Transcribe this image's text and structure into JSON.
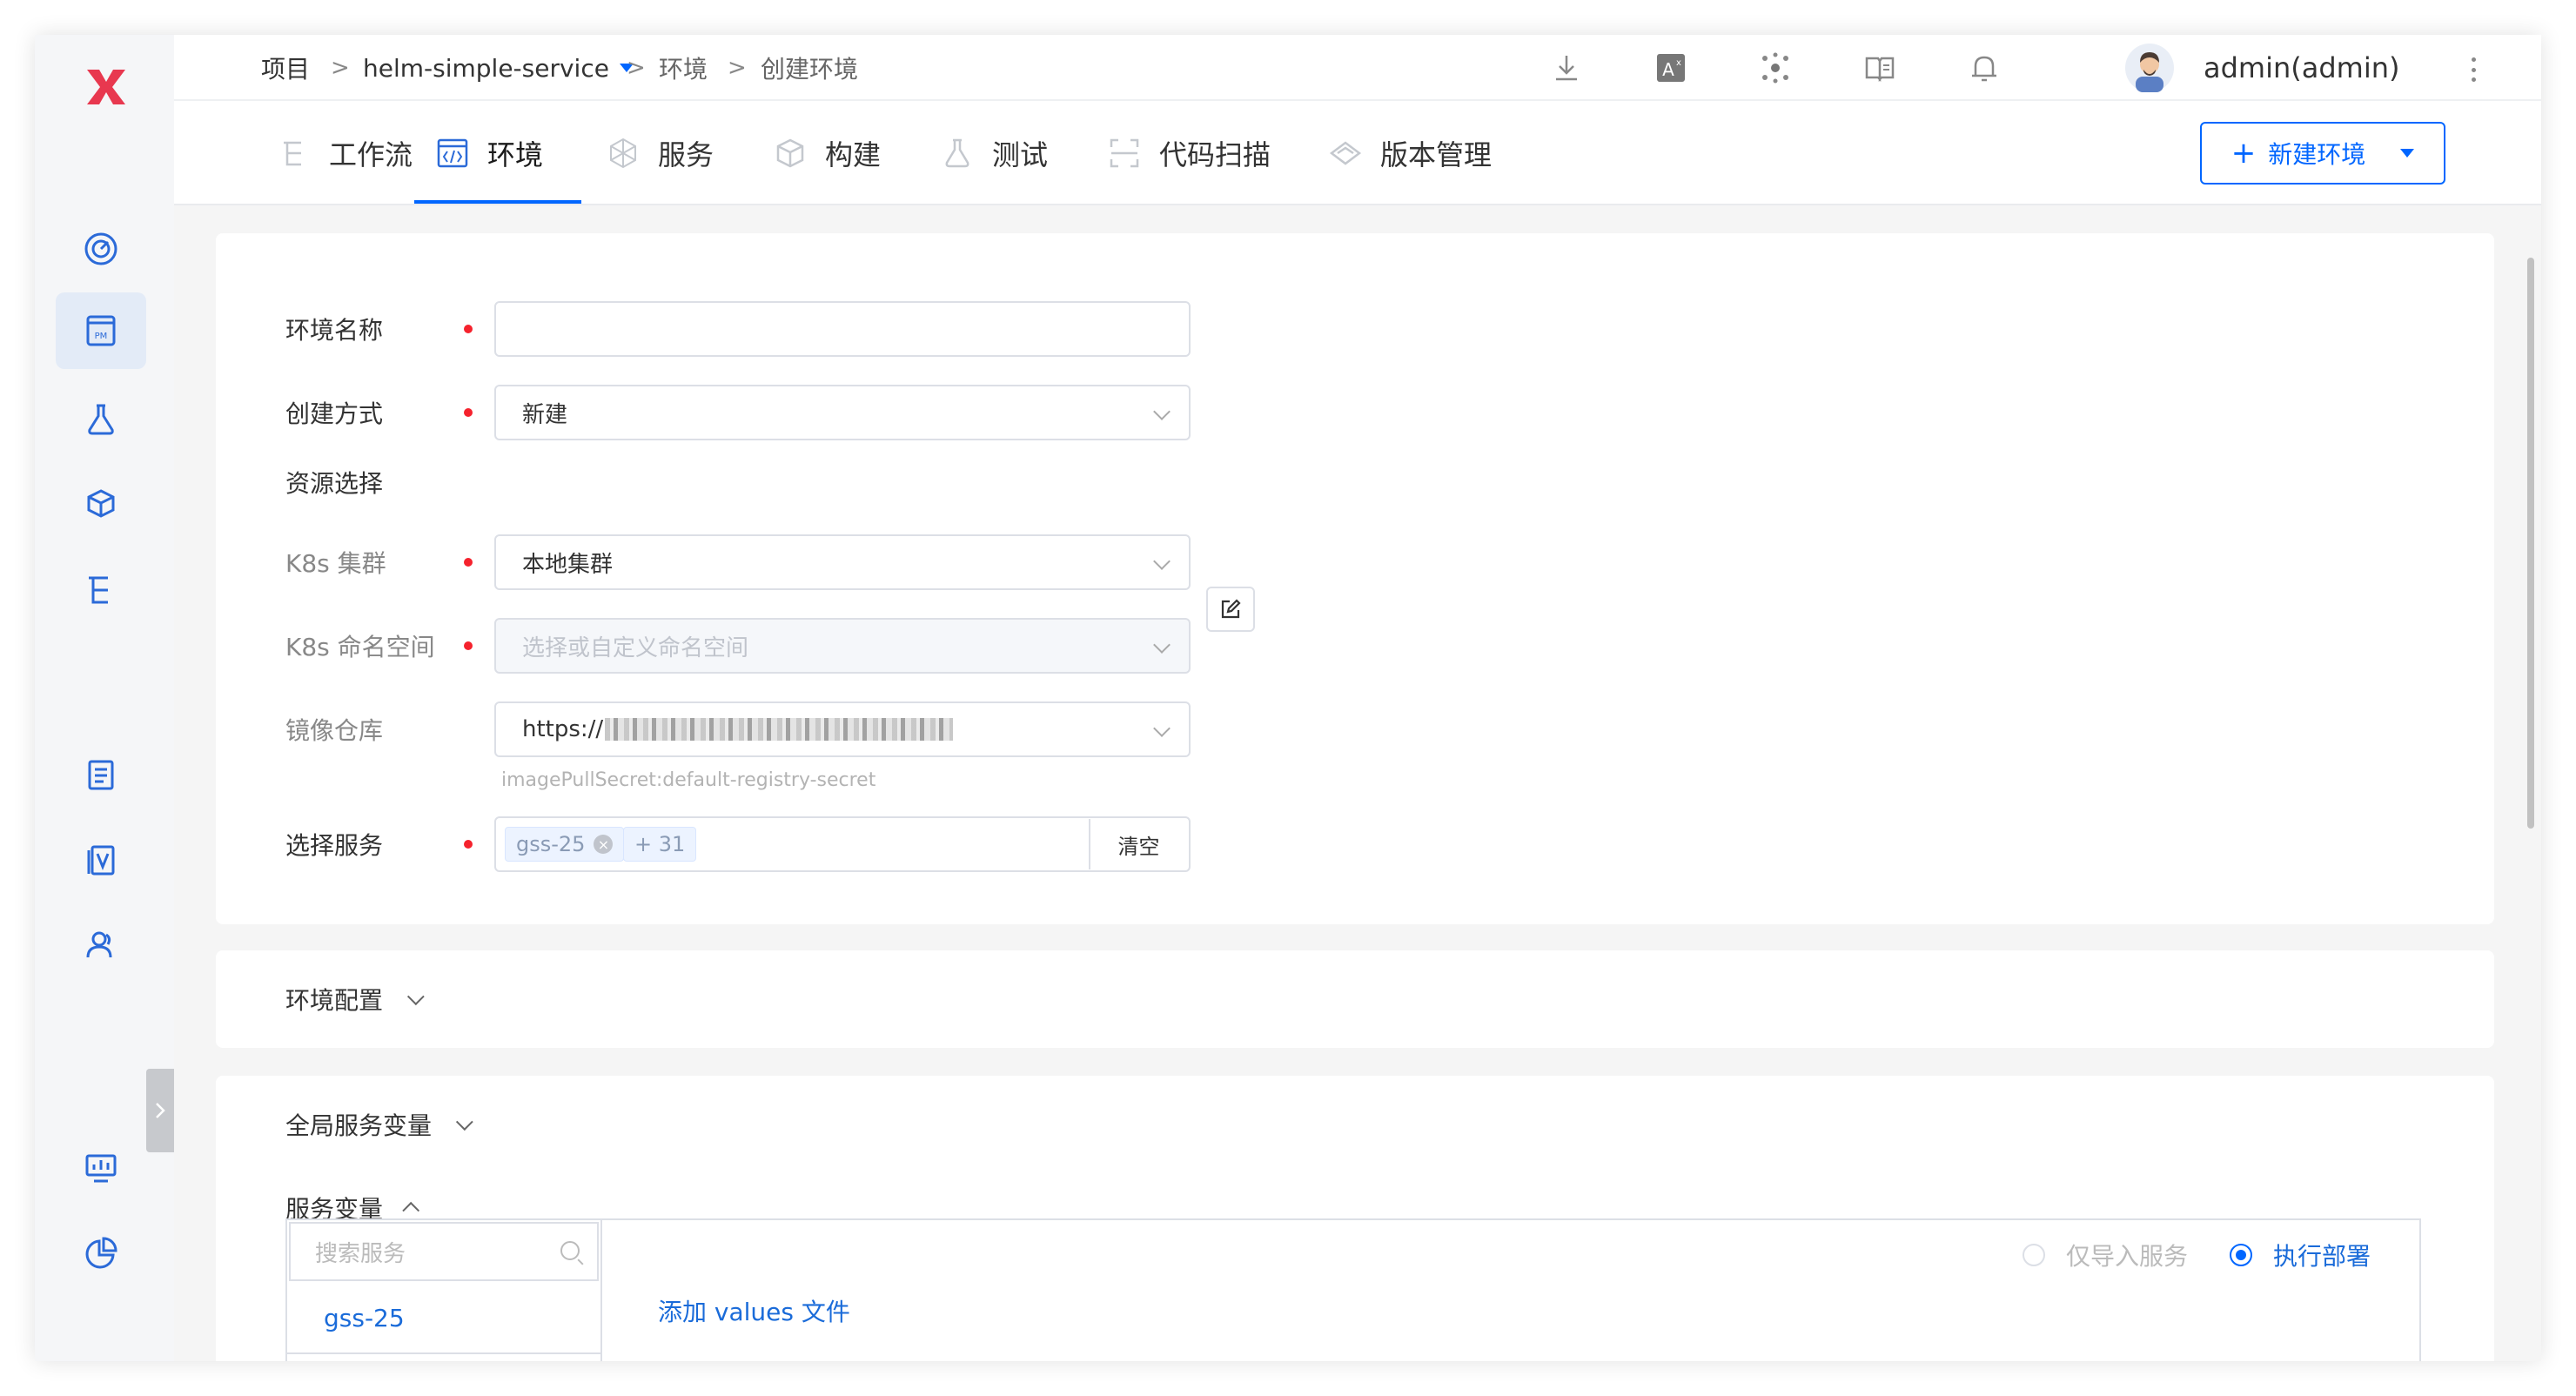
{
  "app": {
    "brand_color": "#e8384f",
    "accent": "#0066ff"
  },
  "breadcrumb": {
    "root": "项目",
    "sep": ">",
    "project": "helm-simple-service",
    "section": "环境",
    "current": "创建环境"
  },
  "topbar": {
    "icons": [
      "download-icon",
      "translate-icon",
      "plugins-icon",
      "docs-icon",
      "bell-icon"
    ],
    "user": "admin(admin)"
  },
  "tabs": [
    {
      "label": "工作流",
      "icon": "workflow-icon",
      "active": false
    },
    {
      "label": "环境",
      "icon": "environment-icon",
      "active": true
    },
    {
      "label": "服务",
      "icon": "service-icon",
      "active": false
    },
    {
      "label": "构建",
      "icon": "build-icon",
      "active": false
    },
    {
      "label": "测试",
      "icon": "test-icon",
      "active": false
    },
    {
      "label": "代码扫描",
      "icon": "scan-icon",
      "active": false
    },
    {
      "label": "版本管理",
      "icon": "release-icon",
      "active": false
    }
  ],
  "actions": {
    "new_env": "新建环境"
  },
  "sidebar": {
    "items": [
      "dashboard-icon",
      "project-icon",
      "test-flask-icon",
      "package-icon",
      "workflow-tree-icon",
      "checklist-icon",
      "version-icon",
      "users-icon",
      "monitor-icon",
      "analytics-icon"
    ]
  },
  "form": {
    "env_name": {
      "label": "环境名称",
      "value": ""
    },
    "create_mode": {
      "label": "创建方式",
      "value": "新建"
    },
    "resource_title": "资源选择",
    "k8s_cluster": {
      "label": "K8s 集群",
      "value": "本地集群"
    },
    "k8s_namespace": {
      "label": "K8s 命名空间",
      "placeholder": "选择或自定义命名空间"
    },
    "registry": {
      "label": "镜像仓库",
      "value": "https://",
      "hint": "imagePullSecret:default-registry-secret"
    },
    "services": {
      "label": "选择服务",
      "tag": "gss-25",
      "more": "+ 31",
      "clear": "清空"
    }
  },
  "sections": {
    "env_config": "环境配置",
    "global_vars": "全局服务变量",
    "service_vars": "服务变量"
  },
  "service_vars": {
    "search_placeholder": "搜索服务",
    "items": [
      "gss-25"
    ],
    "option_import": "仅导入服务",
    "option_deploy": "执行部署",
    "add_values": "添加 values 文件"
  }
}
